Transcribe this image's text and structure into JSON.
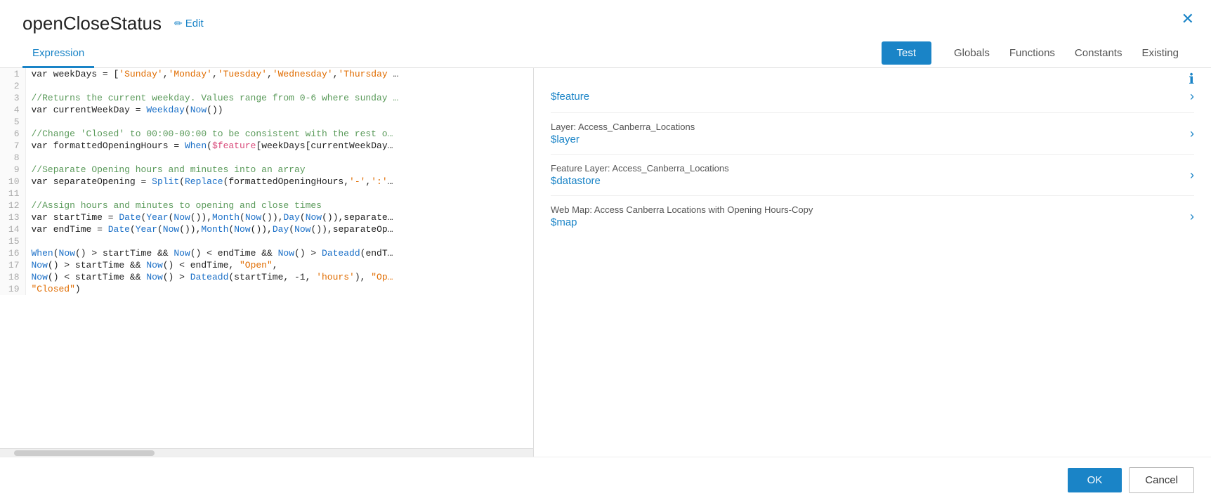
{
  "modal": {
    "title": "openCloseStatus",
    "edit_label": "Edit",
    "close_label": "✕"
  },
  "tabs": {
    "expression_label": "Expression",
    "test_label": "Test",
    "globals_label": "Globals",
    "functions_label": "Functions",
    "constants_label": "Constants",
    "existing_label": "Existing"
  },
  "info_icon": "ℹ",
  "code_lines": [
    {
      "num": "1",
      "content": "var weekDays = ['Sunday','Monday','Tuesday','Wednesday','Thursday …"
    },
    {
      "num": "2",
      "content": ""
    },
    {
      "num": "3",
      "content": "//Returns the current weekday. Values range from 0-6 where sunday …"
    },
    {
      "num": "4",
      "content": "var currentWeekDay = Weekday(Now())"
    },
    {
      "num": "5",
      "content": ""
    },
    {
      "num": "6",
      "content": "//Change 'Closed' to 00:00-00:00 to be consistent with the rest o…"
    },
    {
      "num": "7",
      "content": "var formattedOpeningHours = When($feature[weekDays[currentWeekDay…"
    },
    {
      "num": "8",
      "content": ""
    },
    {
      "num": "9",
      "content": "//Separate Opening hours and minutes into an array"
    },
    {
      "num": "10",
      "content": "var separateOpening = Split(Replace(formattedOpeningHours,'-',':'"
    },
    {
      "num": "11",
      "content": ""
    },
    {
      "num": "12",
      "content": "//Assign hours and minutes to opening and close times"
    },
    {
      "num": "13",
      "content": "var startTime = Date(Year(Now()),Month(Now()),Day(Now()),separate…"
    },
    {
      "num": "14",
      "content": "var endTime = Date(Year(Now()),Month(Now()),Day(Now()),separateOp…"
    },
    {
      "num": "15",
      "content": ""
    },
    {
      "num": "16",
      "content": "When(Now() > startTime && Now() < endTime && Now() > Dateadd(endT…"
    },
    {
      "num": "17",
      "content": "Now() > startTime && Now() < endTime, \"Open\","
    },
    {
      "num": "18",
      "content": "Now() < startTime && Now() > Dateadd(startTime, -1, 'hours'), \"Op…"
    },
    {
      "num": "19",
      "content": "\"Closed\")"
    }
  ],
  "globals": [
    {
      "label": "",
      "value": "$feature"
    },
    {
      "label": "Layer: Access_Canberra_Locations",
      "value": "$layer"
    },
    {
      "label": "Feature Layer: Access_Canberra_Locations",
      "value": "$datastore"
    },
    {
      "label": "Web Map: Access Canberra Locations with Opening Hours-Copy",
      "value": "$map"
    }
  ],
  "footer": {
    "ok_label": "OK",
    "cancel_label": "Cancel"
  }
}
